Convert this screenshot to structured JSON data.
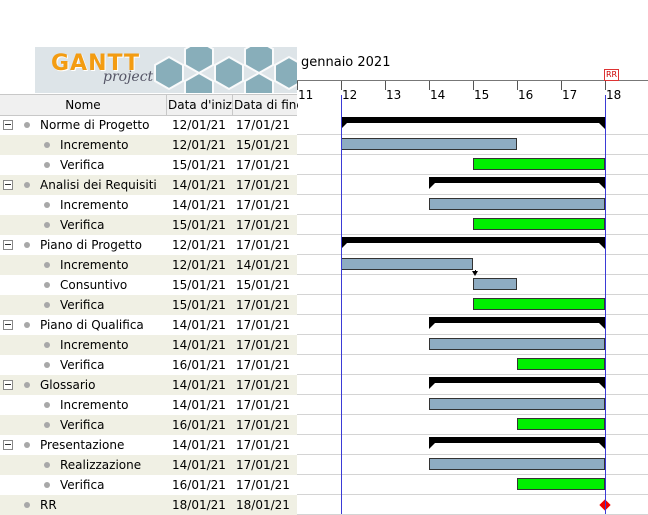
{
  "logo": {
    "title": "GANTT",
    "subtitle": "project"
  },
  "columns": {
    "name": "Nome",
    "start": "Data d'iniz...",
    "end": "Data di fine"
  },
  "timeline": {
    "month": "gennaio 2021",
    "days": [
      "11",
      "12",
      "13",
      "14",
      "15",
      "16",
      "17",
      "18"
    ],
    "milestone_marker": "RR"
  },
  "tasks": [
    {
      "name": "Norme di Progetto",
      "start": "12/01/21",
      "end": "17/01/21",
      "level": 0,
      "type": "summary",
      "s": 12,
      "e": 18
    },
    {
      "name": "Incremento",
      "start": "12/01/21",
      "end": "15/01/21",
      "level": 1,
      "type": "inc",
      "s": 12,
      "e": 16
    },
    {
      "name": "Verifica",
      "start": "15/01/21",
      "end": "17/01/21",
      "level": 1,
      "type": "ver",
      "s": 15,
      "e": 18
    },
    {
      "name": "Analisi dei Requisiti",
      "start": "14/01/21",
      "end": "17/01/21",
      "level": 0,
      "type": "summary",
      "s": 14,
      "e": 18
    },
    {
      "name": "Incremento",
      "start": "14/01/21",
      "end": "17/01/21",
      "level": 1,
      "type": "inc",
      "s": 14,
      "e": 18
    },
    {
      "name": "Verifica",
      "start": "15/01/21",
      "end": "17/01/21",
      "level": 1,
      "type": "ver",
      "s": 15,
      "e": 18
    },
    {
      "name": "Piano di Progetto",
      "start": "12/01/21",
      "end": "17/01/21",
      "level": 0,
      "type": "summary",
      "s": 12,
      "e": 18
    },
    {
      "name": "Incremento",
      "start": "12/01/21",
      "end": "14/01/21",
      "level": 1,
      "type": "inc",
      "s": 12,
      "e": 15
    },
    {
      "name": "Consuntivo",
      "start": "15/01/21",
      "end": "15/01/21",
      "level": 1,
      "type": "con",
      "s": 15,
      "e": 16
    },
    {
      "name": "Verifica",
      "start": "15/01/21",
      "end": "17/01/21",
      "level": 1,
      "type": "ver",
      "s": 15,
      "e": 18
    },
    {
      "name": "Piano di Qualifica",
      "start": "14/01/21",
      "end": "17/01/21",
      "level": 0,
      "type": "summary",
      "s": 14,
      "e": 18
    },
    {
      "name": "Incremento",
      "start": "14/01/21",
      "end": "17/01/21",
      "level": 1,
      "type": "inc",
      "s": 14,
      "e": 18
    },
    {
      "name": "Verifica",
      "start": "16/01/21",
      "end": "17/01/21",
      "level": 1,
      "type": "ver",
      "s": 16,
      "e": 18
    },
    {
      "name": "Glossario",
      "start": "14/01/21",
      "end": "17/01/21",
      "level": 0,
      "type": "summary",
      "s": 14,
      "e": 18
    },
    {
      "name": "Incremento",
      "start": "14/01/21",
      "end": "17/01/21",
      "level": 1,
      "type": "inc",
      "s": 14,
      "e": 18
    },
    {
      "name": "Verifica",
      "start": "16/01/21",
      "end": "17/01/21",
      "level": 1,
      "type": "ver",
      "s": 16,
      "e": 18
    },
    {
      "name": "Presentazione",
      "start": "14/01/21",
      "end": "17/01/21",
      "level": 0,
      "type": "summary",
      "s": 14,
      "e": 18
    },
    {
      "name": "Realizzazione",
      "start": "14/01/21",
      "end": "17/01/21",
      "level": 1,
      "type": "inc",
      "s": 14,
      "e": 18
    },
    {
      "name": "Verifica",
      "start": "16/01/21",
      "end": "17/01/21",
      "level": 1,
      "type": "ver",
      "s": 16,
      "e": 18
    },
    {
      "name": "RR",
      "start": "18/01/21",
      "end": "18/01/21",
      "level": 0,
      "type": "milestone",
      "s": 18,
      "e": 18
    }
  ],
  "colors": {
    "increment": "#8eacc2",
    "verify": "#00f000",
    "summary": "#000000",
    "milestone": "#f00000",
    "today": "#3b3bd6",
    "alt_row": "#f0f0e4"
  }
}
